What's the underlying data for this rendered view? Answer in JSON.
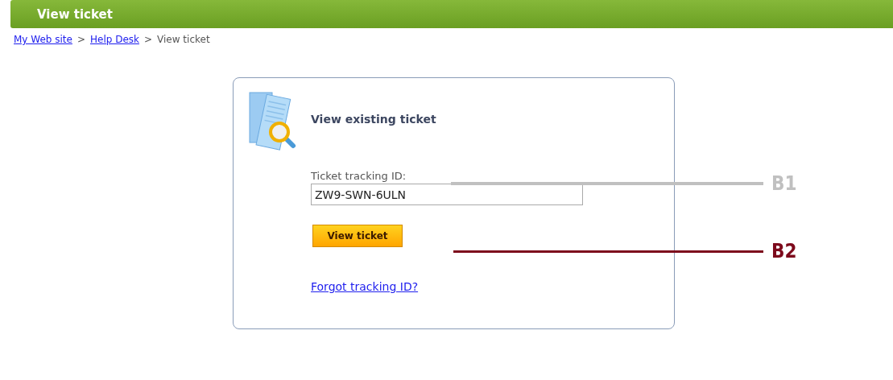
{
  "header": {
    "title": "View ticket"
  },
  "breadcrumb": {
    "items": [
      {
        "label": "My Web site",
        "kind": "link"
      },
      {
        "label": ">",
        "kind": "separator"
      },
      {
        "label": "Help Desk",
        "kind": "link"
      },
      {
        "label": ">",
        "kind": "separator"
      },
      {
        "label": "View ticket",
        "kind": "current"
      }
    ]
  },
  "card": {
    "title": "View existing ticket",
    "field_label": "Ticket tracking ID:",
    "field_value": "ZW9-SWN-6ULN",
    "button": "View ticket",
    "link": "Forgot tracking ID?"
  },
  "annotations": [
    {
      "label": "B1",
      "color": "#c0c0c0"
    },
    {
      "label": "B2",
      "color": "#7d0a1c"
    }
  ]
}
